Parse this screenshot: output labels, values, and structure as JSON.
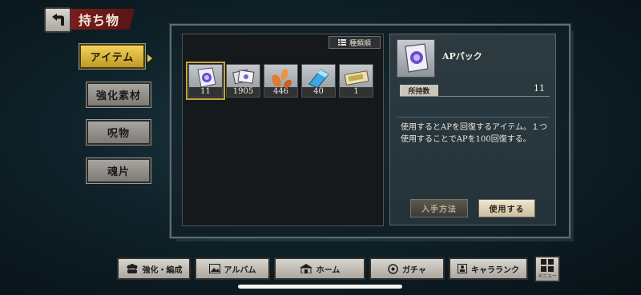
{
  "header": {
    "title": "持ち物"
  },
  "tabs": [
    {
      "label": "アイテム",
      "active": true
    },
    {
      "label": "強化素材",
      "active": false
    },
    {
      "label": "呪物",
      "active": false
    },
    {
      "label": "魂片",
      "active": false
    }
  ],
  "sort": {
    "label": "種類順"
  },
  "items": [
    {
      "icon": "ap-pack-icon",
      "count": "11",
      "selected": true
    },
    {
      "icon": "card-stack-icon",
      "count": "1905",
      "selected": false
    },
    {
      "icon": "petals-icon",
      "count": "446",
      "selected": false
    },
    {
      "icon": "crystal-icon",
      "count": "40",
      "selected": false
    },
    {
      "icon": "ticket-icon",
      "count": "1",
      "selected": false
    }
  ],
  "detail": {
    "name": "APパック",
    "owned_label": "所持数",
    "owned_value": "11",
    "description": "使用するとAPを回復するアイテム。１つ使用することでAPを100回復する。",
    "howto_label": "入手方法",
    "use_label": "使用する"
  },
  "bottom_nav": [
    {
      "label": "強化・編成",
      "icon": "team-icon"
    },
    {
      "label": "アルバム",
      "icon": "album-icon"
    },
    {
      "label": "ホーム",
      "icon": "home-icon"
    },
    {
      "label": "ガチャ",
      "icon": "gacha-icon"
    },
    {
      "label": "キャラランク",
      "icon": "rank-icon"
    }
  ],
  "menu": {
    "label": "メニュー"
  },
  "colors": {
    "active_tab": "#e1bf45",
    "title_ribbon": "#7a1d1d",
    "selection": "#c7a43c"
  }
}
